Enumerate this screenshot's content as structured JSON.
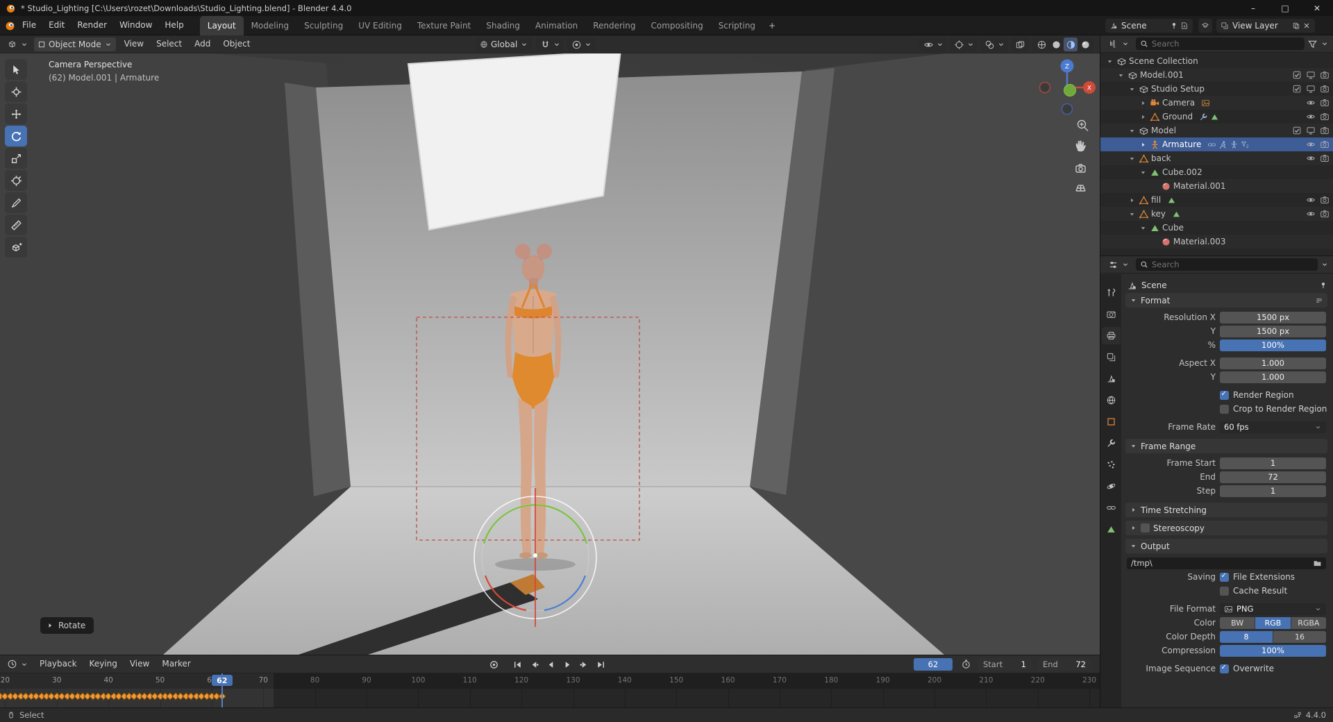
{
  "colors": {
    "accent": "#4772b3",
    "selection": "#3e5c96",
    "keyframe": "#f19a38",
    "object_orange": "#e0883a",
    "data_green": "#7fc173"
  },
  "window": {
    "title": "* Studio_Lighting [C:\\Users\\rozet\\Downloads\\Studio_Lighting.blend] - Blender 4.4.0"
  },
  "topbar": {
    "menus": [
      "File",
      "Edit",
      "Render",
      "Window",
      "Help"
    ],
    "workspaces": [
      "Layout",
      "Modeling",
      "Sculpting",
      "UV Editing",
      "Texture Paint",
      "Shading",
      "Animation",
      "Rendering",
      "Compositing",
      "Scripting"
    ],
    "active_workspace": "Layout",
    "add_workspace": "+",
    "scene": "Scene",
    "view_layer": "View Layer"
  },
  "viewport": {
    "mode": "Object Mode",
    "menus": [
      "View",
      "Select",
      "Add",
      "Object"
    ],
    "orientation": "Global",
    "overlay_line1": "Camera Perspective",
    "overlay_line2": "(62) Model.001 | Armature",
    "operator": "Rotate",
    "axis_z": "Z",
    "axis_x": "X"
  },
  "outliner": {
    "search_placeholder": "Search",
    "rows": [
      {
        "indent": 0,
        "expand": "open",
        "icon": "collection",
        "label": "Scene Collection",
        "right": []
      },
      {
        "indent": 1,
        "expand": "open",
        "icon": "collection",
        "label": "Model.001",
        "right": [
          "check",
          "monitor",
          "camera"
        ]
      },
      {
        "indent": 2,
        "expand": "open",
        "icon": "collection",
        "label": "Studio Setup",
        "right": [
          "check",
          "monitor",
          "camera"
        ]
      },
      {
        "indent": 3,
        "expand": "closed",
        "icon": "camera-obj",
        "label": "Camera",
        "badges": [
          "image"
        ],
        "right": [
          "eye",
          "camera"
        ]
      },
      {
        "indent": 3,
        "expand": "closed",
        "icon": "mesh-obj",
        "label": "Ground",
        "badges": [
          "wrench",
          "mesh-data"
        ],
        "right": [
          "eye",
          "camera"
        ]
      },
      {
        "indent": 2,
        "expand": "open",
        "icon": "collection",
        "label": "Model",
        "right": [
          "check",
          "monitor",
          "camera"
        ]
      },
      {
        "indent": 3,
        "expand": "closed",
        "icon": "armature-obj",
        "label": "Armature",
        "selected": true,
        "badges": [
          "constraint",
          "run",
          "pose",
          "filter2"
        ],
        "right": [
          "eye",
          "camera"
        ]
      },
      {
        "indent": 2,
        "expand": "open",
        "icon": "mesh-obj",
        "label": "back",
        "right": [
          "eye",
          "camera"
        ]
      },
      {
        "indent": 3,
        "expand": "open",
        "icon": "mesh-data",
        "label": "Cube.002",
        "right": []
      },
      {
        "indent": 4,
        "expand": "none",
        "icon": "material",
        "label": "Material.001",
        "right": []
      },
      {
        "indent": 2,
        "expand": "closed",
        "icon": "mesh-obj",
        "label": "fill",
        "badges": [
          "mesh-data"
        ],
        "right": [
          "eye",
          "camera"
        ]
      },
      {
        "indent": 2,
        "expand": "open",
        "icon": "mesh-obj",
        "label": "key",
        "badges": [
          "mesh-data"
        ],
        "right": [
          "eye",
          "camera"
        ]
      },
      {
        "indent": 3,
        "expand": "open",
        "icon": "mesh-data",
        "label": "Cube",
        "right": []
      },
      {
        "indent": 4,
        "expand": "none",
        "icon": "material",
        "label": "Material.003",
        "right": []
      }
    ]
  },
  "properties": {
    "search_placeholder": "Search",
    "breadcrumb": "Scene",
    "tabs": [
      "tool",
      "render",
      "output",
      "view-layer",
      "scene",
      "world",
      "object",
      "modifiers",
      "particles",
      "physics",
      "constraints",
      "object-data"
    ],
    "active_tab": "output",
    "sections": [
      {
        "title": "Format",
        "expanded": true,
        "preset": true,
        "rows": [
          {
            "type": "number",
            "label": "Resolution X",
            "value": "1500 px"
          },
          {
            "type": "number",
            "label": "Y",
            "value": "1500 px"
          },
          {
            "type": "slider",
            "label": "%",
            "value": "100%"
          },
          {
            "type": "spacer"
          },
          {
            "type": "number",
            "label": "Aspect X",
            "value": "1.000"
          },
          {
            "type": "number",
            "label": "Y",
            "value": "1.000"
          },
          {
            "type": "spacer"
          },
          {
            "type": "checkbox",
            "label": "",
            "text": "Render Region",
            "checked": true
          },
          {
            "type": "checkbox",
            "label": "",
            "text": "Crop to Render Region",
            "checked": false
          },
          {
            "type": "spacer"
          },
          {
            "type": "dropdown",
            "label": "Frame Rate",
            "value": "60 fps"
          }
        ]
      },
      {
        "title": "Frame Range",
        "expanded": true,
        "rows": [
          {
            "type": "number",
            "label": "Frame Start",
            "value": "1"
          },
          {
            "type": "number",
            "label": "End",
            "value": "72"
          },
          {
            "type": "number",
            "label": "Step",
            "value": "1"
          }
        ]
      },
      {
        "title": "Time Stretching",
        "expanded": false,
        "rows": []
      },
      {
        "title": "Stereoscopy",
        "expanded": false,
        "checkbox": true,
        "rows": []
      },
      {
        "title": "Output",
        "expanded": true,
        "rows": [
          {
            "type": "path",
            "value": "/tmp\\"
          },
          {
            "type": "checkbox",
            "label": "Saving",
            "text": "File Extensions",
            "checked": true
          },
          {
            "type": "checkbox",
            "label": "",
            "text": "Cache Result",
            "checked": false
          },
          {
            "type": "spacer"
          },
          {
            "type": "dropdown",
            "label": "File Format",
            "value": "PNG",
            "icon": "image"
          },
          {
            "type": "segmented",
            "label": "Color",
            "options": [
              "BW",
              "RGB",
              "RGBA"
            ],
            "active": 1
          },
          {
            "type": "segmented",
            "label": "Color Depth",
            "options": [
              "8",
              "16"
            ],
            "active": 0
          },
          {
            "type": "slider",
            "label": "Compression",
            "value": "100%"
          },
          {
            "type": "spacer"
          },
          {
            "type": "checkbox",
            "label": "Image Sequence",
            "text": "Overwrite",
            "checked": true
          }
        ]
      }
    ]
  },
  "timeline": {
    "menus": [
      "Playback",
      "Keying",
      "View",
      "Marker"
    ],
    "current_frame": 62,
    "frame_start_label": "Start",
    "frame_start": 1,
    "frame_end_label": "End",
    "frame_end": 72,
    "ruler_ticks": [
      20,
      30,
      40,
      50,
      60,
      70,
      80,
      90,
      100,
      110,
      120,
      130,
      140,
      150,
      160,
      170,
      180,
      190,
      200,
      210,
      220,
      230
    ],
    "keyframes": {
      "from": 19,
      "to": 62
    },
    "view": {
      "left_frame": 19,
      "right_frame": 232
    }
  },
  "statusbar": {
    "left": "Select",
    "right": "4.4.0"
  }
}
